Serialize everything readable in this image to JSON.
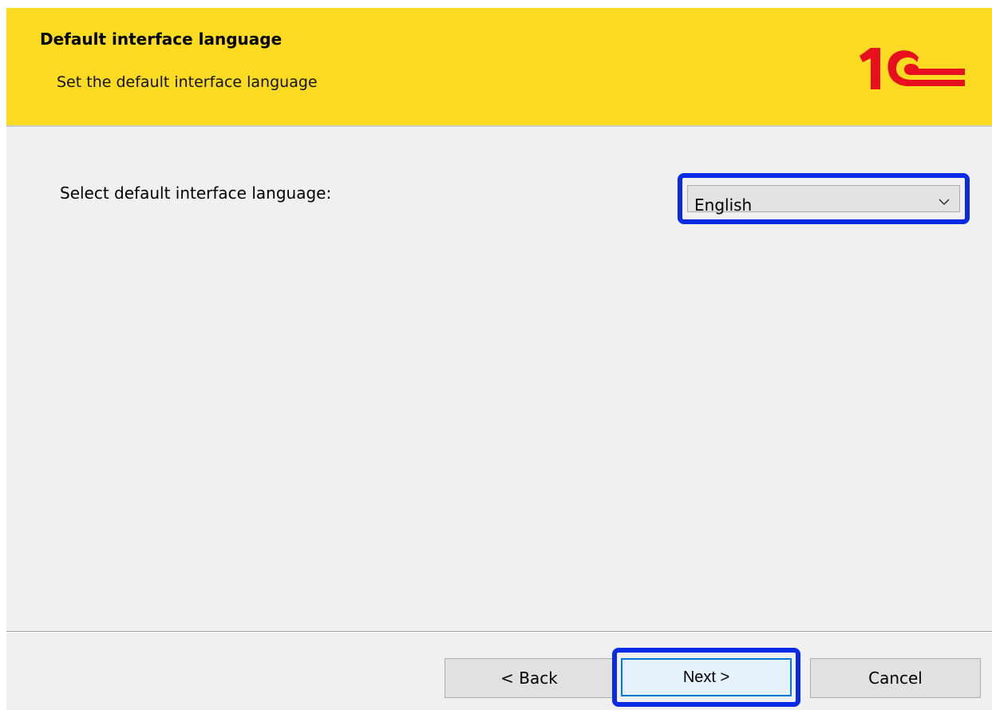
{
  "header": {
    "title": "Default interface language",
    "subtitle": "Set the default interface language",
    "logo_text": "1C",
    "background_color": "#fcdb22",
    "logo_color": "#e8101e"
  },
  "main": {
    "prompt_label": "Select default interface language:",
    "language_select": {
      "selected": "English",
      "icon": "chevron-down-icon"
    }
  },
  "footer": {
    "back_label": "< Back",
    "next_label": "Next >",
    "cancel_label": "Cancel"
  },
  "highlight_color": "#0a2be6"
}
